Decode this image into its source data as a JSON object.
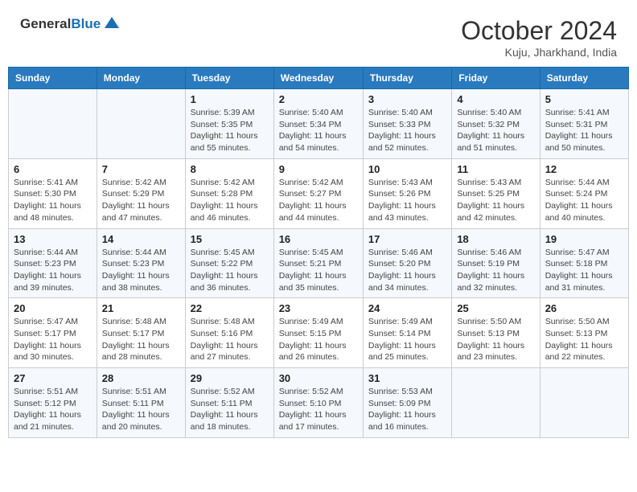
{
  "header": {
    "logo_general": "General",
    "logo_blue": "Blue",
    "month_title": "October 2024",
    "location": "Kuju, Jharkhand, India"
  },
  "calendar": {
    "days_of_week": [
      "Sunday",
      "Monday",
      "Tuesday",
      "Wednesday",
      "Thursday",
      "Friday",
      "Saturday"
    ],
    "weeks": [
      [
        {
          "day": "",
          "info": ""
        },
        {
          "day": "",
          "info": ""
        },
        {
          "day": "1",
          "sunrise": "Sunrise: 5:39 AM",
          "sunset": "Sunset: 5:35 PM",
          "daylight": "Daylight: 11 hours and 55 minutes."
        },
        {
          "day": "2",
          "sunrise": "Sunrise: 5:40 AM",
          "sunset": "Sunset: 5:34 PM",
          "daylight": "Daylight: 11 hours and 54 minutes."
        },
        {
          "day": "3",
          "sunrise": "Sunrise: 5:40 AM",
          "sunset": "Sunset: 5:33 PM",
          "daylight": "Daylight: 11 hours and 52 minutes."
        },
        {
          "day": "4",
          "sunrise": "Sunrise: 5:40 AM",
          "sunset": "Sunset: 5:32 PM",
          "daylight": "Daylight: 11 hours and 51 minutes."
        },
        {
          "day": "5",
          "sunrise": "Sunrise: 5:41 AM",
          "sunset": "Sunset: 5:31 PM",
          "daylight": "Daylight: 11 hours and 50 minutes."
        }
      ],
      [
        {
          "day": "6",
          "sunrise": "Sunrise: 5:41 AM",
          "sunset": "Sunset: 5:30 PM",
          "daylight": "Daylight: 11 hours and 48 minutes."
        },
        {
          "day": "7",
          "sunrise": "Sunrise: 5:42 AM",
          "sunset": "Sunset: 5:29 PM",
          "daylight": "Daylight: 11 hours and 47 minutes."
        },
        {
          "day": "8",
          "sunrise": "Sunrise: 5:42 AM",
          "sunset": "Sunset: 5:28 PM",
          "daylight": "Daylight: 11 hours and 46 minutes."
        },
        {
          "day": "9",
          "sunrise": "Sunrise: 5:42 AM",
          "sunset": "Sunset: 5:27 PM",
          "daylight": "Daylight: 11 hours and 44 minutes."
        },
        {
          "day": "10",
          "sunrise": "Sunrise: 5:43 AM",
          "sunset": "Sunset: 5:26 PM",
          "daylight": "Daylight: 11 hours and 43 minutes."
        },
        {
          "day": "11",
          "sunrise": "Sunrise: 5:43 AM",
          "sunset": "Sunset: 5:25 PM",
          "daylight": "Daylight: 11 hours and 42 minutes."
        },
        {
          "day": "12",
          "sunrise": "Sunrise: 5:44 AM",
          "sunset": "Sunset: 5:24 PM",
          "daylight": "Daylight: 11 hours and 40 minutes."
        }
      ],
      [
        {
          "day": "13",
          "sunrise": "Sunrise: 5:44 AM",
          "sunset": "Sunset: 5:23 PM",
          "daylight": "Daylight: 11 hours and 39 minutes."
        },
        {
          "day": "14",
          "sunrise": "Sunrise: 5:44 AM",
          "sunset": "Sunset: 5:23 PM",
          "daylight": "Daylight: 11 hours and 38 minutes."
        },
        {
          "day": "15",
          "sunrise": "Sunrise: 5:45 AM",
          "sunset": "Sunset: 5:22 PM",
          "daylight": "Daylight: 11 hours and 36 minutes."
        },
        {
          "day": "16",
          "sunrise": "Sunrise: 5:45 AM",
          "sunset": "Sunset: 5:21 PM",
          "daylight": "Daylight: 11 hours and 35 minutes."
        },
        {
          "day": "17",
          "sunrise": "Sunrise: 5:46 AM",
          "sunset": "Sunset: 5:20 PM",
          "daylight": "Daylight: 11 hours and 34 minutes."
        },
        {
          "day": "18",
          "sunrise": "Sunrise: 5:46 AM",
          "sunset": "Sunset: 5:19 PM",
          "daylight": "Daylight: 11 hours and 32 minutes."
        },
        {
          "day": "19",
          "sunrise": "Sunrise: 5:47 AM",
          "sunset": "Sunset: 5:18 PM",
          "daylight": "Daylight: 11 hours and 31 minutes."
        }
      ],
      [
        {
          "day": "20",
          "sunrise": "Sunrise: 5:47 AM",
          "sunset": "Sunset: 5:17 PM",
          "daylight": "Daylight: 11 hours and 30 minutes."
        },
        {
          "day": "21",
          "sunrise": "Sunrise: 5:48 AM",
          "sunset": "Sunset: 5:17 PM",
          "daylight": "Daylight: 11 hours and 28 minutes."
        },
        {
          "day": "22",
          "sunrise": "Sunrise: 5:48 AM",
          "sunset": "Sunset: 5:16 PM",
          "daylight": "Daylight: 11 hours and 27 minutes."
        },
        {
          "day": "23",
          "sunrise": "Sunrise: 5:49 AM",
          "sunset": "Sunset: 5:15 PM",
          "daylight": "Daylight: 11 hours and 26 minutes."
        },
        {
          "day": "24",
          "sunrise": "Sunrise: 5:49 AM",
          "sunset": "Sunset: 5:14 PM",
          "daylight": "Daylight: 11 hours and 25 minutes."
        },
        {
          "day": "25",
          "sunrise": "Sunrise: 5:50 AM",
          "sunset": "Sunset: 5:13 PM",
          "daylight": "Daylight: 11 hours and 23 minutes."
        },
        {
          "day": "26",
          "sunrise": "Sunrise: 5:50 AM",
          "sunset": "Sunset: 5:13 PM",
          "daylight": "Daylight: 11 hours and 22 minutes."
        }
      ],
      [
        {
          "day": "27",
          "sunrise": "Sunrise: 5:51 AM",
          "sunset": "Sunset: 5:12 PM",
          "daylight": "Daylight: 11 hours and 21 minutes."
        },
        {
          "day": "28",
          "sunrise": "Sunrise: 5:51 AM",
          "sunset": "Sunset: 5:11 PM",
          "daylight": "Daylight: 11 hours and 20 minutes."
        },
        {
          "day": "29",
          "sunrise": "Sunrise: 5:52 AM",
          "sunset": "Sunset: 5:11 PM",
          "daylight": "Daylight: 11 hours and 18 minutes."
        },
        {
          "day": "30",
          "sunrise": "Sunrise: 5:52 AM",
          "sunset": "Sunset: 5:10 PM",
          "daylight": "Daylight: 11 hours and 17 minutes."
        },
        {
          "day": "31",
          "sunrise": "Sunrise: 5:53 AM",
          "sunset": "Sunset: 5:09 PM",
          "daylight": "Daylight: 11 hours and 16 minutes."
        },
        {
          "day": "",
          "info": ""
        },
        {
          "day": "",
          "info": ""
        }
      ]
    ]
  }
}
